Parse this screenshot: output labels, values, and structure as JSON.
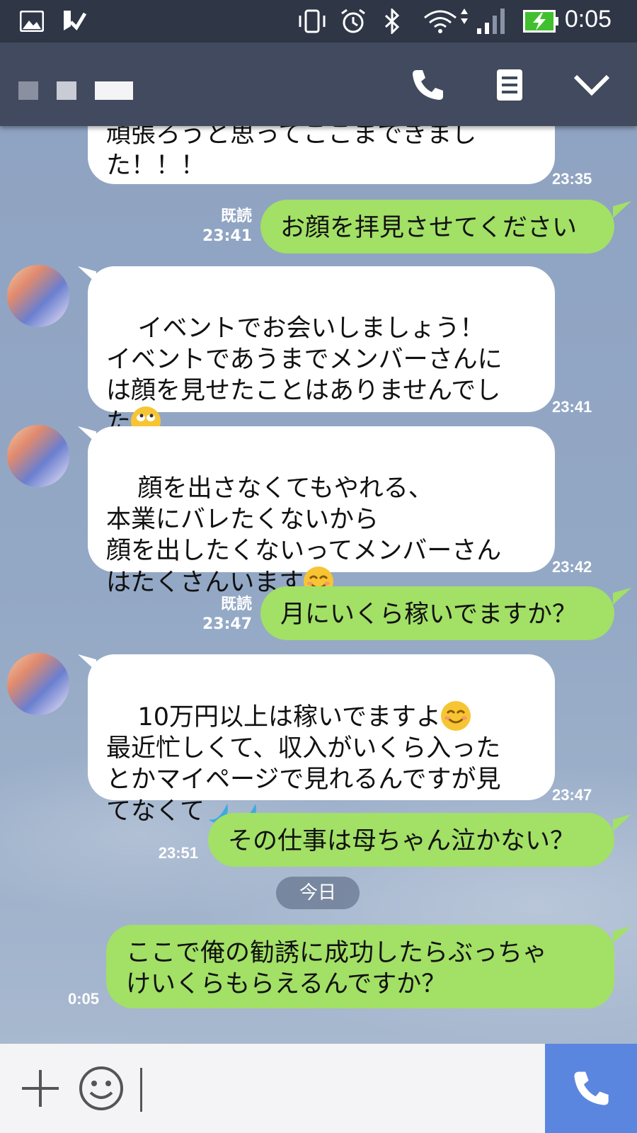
{
  "status_bar": {
    "time": "0:05",
    "icons": [
      "gallery-icon",
      "check-icon",
      "vibrate-icon",
      "alarm-icon",
      "bluetooth-icon",
      "wifi-icon",
      "signal-icon",
      "battery-charging-icon"
    ]
  },
  "header": {
    "contact_name": "",
    "buttons": [
      "phone-icon",
      "menu-icon",
      "chevron-down-icon"
    ]
  },
  "messages": [
    {
      "side": "in",
      "text": "頑張ろうと思ってここまできまし\nた！！！",
      "time": "23:35"
    },
    {
      "side": "out",
      "text": "お顔を拝見させてください",
      "read": "既読",
      "time": "23:41"
    },
    {
      "side": "in",
      "text": "イベントでお会いしましょう！\nイベントであうまでメンバーさんに\nは顔を見せたことはありませんでし\nた",
      "emoji": "rolling-eyes-emoji",
      "time": "23:41"
    },
    {
      "side": "in",
      "text": "顔を出さなくてもやれる、\n本業にバレたくないから\n顔を出したくないってメンバーさん\nはたくさんいます",
      "emoji": "smile-emoji",
      "time": "23:42"
    },
    {
      "side": "out",
      "text": "月にいくら稼いでますか？",
      "read": "既読",
      "time": "23:47"
    },
    {
      "side": "in",
      "text_line1": "10万円以上は稼いでますよ",
      "text_rest": "\n最近忙しくて、収入がいくら入った\nとかマイページで見れるんですが見\nてなくて",
      "emoji": "sweat-drops-emoji",
      "time": "23:47"
    },
    {
      "side": "out",
      "text": "その仕事は母ちゃん泣かない？",
      "time": "23:51"
    },
    {
      "side": "out",
      "text": "ここで俺の勧誘に成功したらぶっちゃ\nけいくらもらえるんですか？",
      "time": "0:05"
    }
  ],
  "date_separator": "今日",
  "input_bar": {
    "placeholder": "",
    "icons": [
      "plus-icon",
      "emoji-icon",
      "call-icon"
    ]
  },
  "colors": {
    "status_bar": "#2f3646",
    "header": "#414a5e",
    "out_bubble": "#a2e066",
    "in_bubble": "#ffffff",
    "call_button": "#5b86e0"
  }
}
